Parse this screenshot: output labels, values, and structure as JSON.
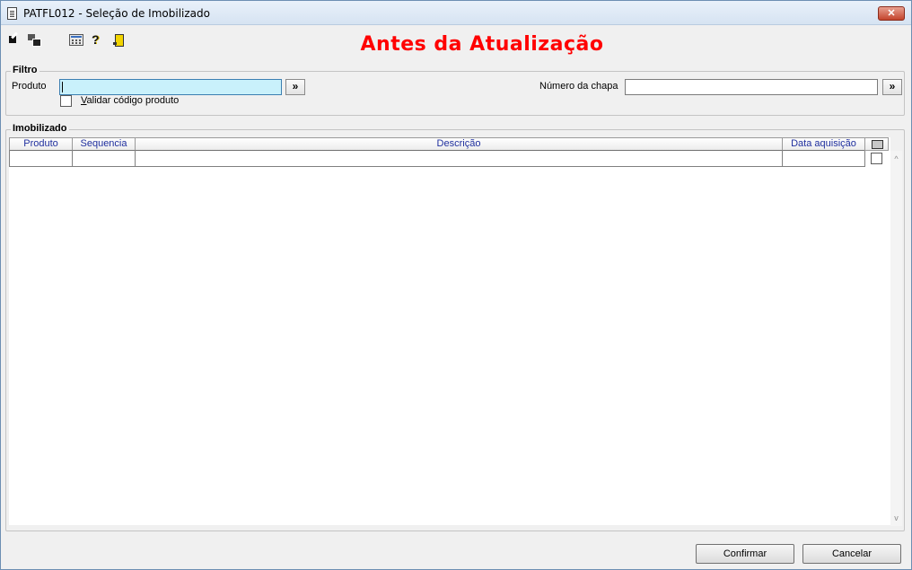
{
  "window": {
    "title": "PATFL012 - Seleção de Imobilizado",
    "close_glyph": "✕"
  },
  "toolbar": {
    "icons": [
      "arrow-icon",
      "windows-icon",
      "calculator-icon",
      "help-icon",
      "exit-icon"
    ],
    "help_glyph": "?"
  },
  "banner": {
    "text": "Antes da Atualização",
    "color": "#ff0000"
  },
  "filter": {
    "legend": "Filtro",
    "produto_label": "Produto",
    "produto_value": "",
    "go_label": "»",
    "validar_prefix": "V",
    "validar_rest": "alidar código produto",
    "validar_checked": false,
    "chapa_label": "Número da chapa",
    "chapa_value": ""
  },
  "imobilizado": {
    "legend": "Imobilizado",
    "columns": [
      "Produto",
      "Sequencia",
      "Descrição",
      "Data aquisição"
    ],
    "rows": [],
    "scroll_up": "^",
    "scroll_down": "v"
  },
  "footer": {
    "confirm_label": "Confirmar",
    "cancel_label": "Cancelar"
  }
}
